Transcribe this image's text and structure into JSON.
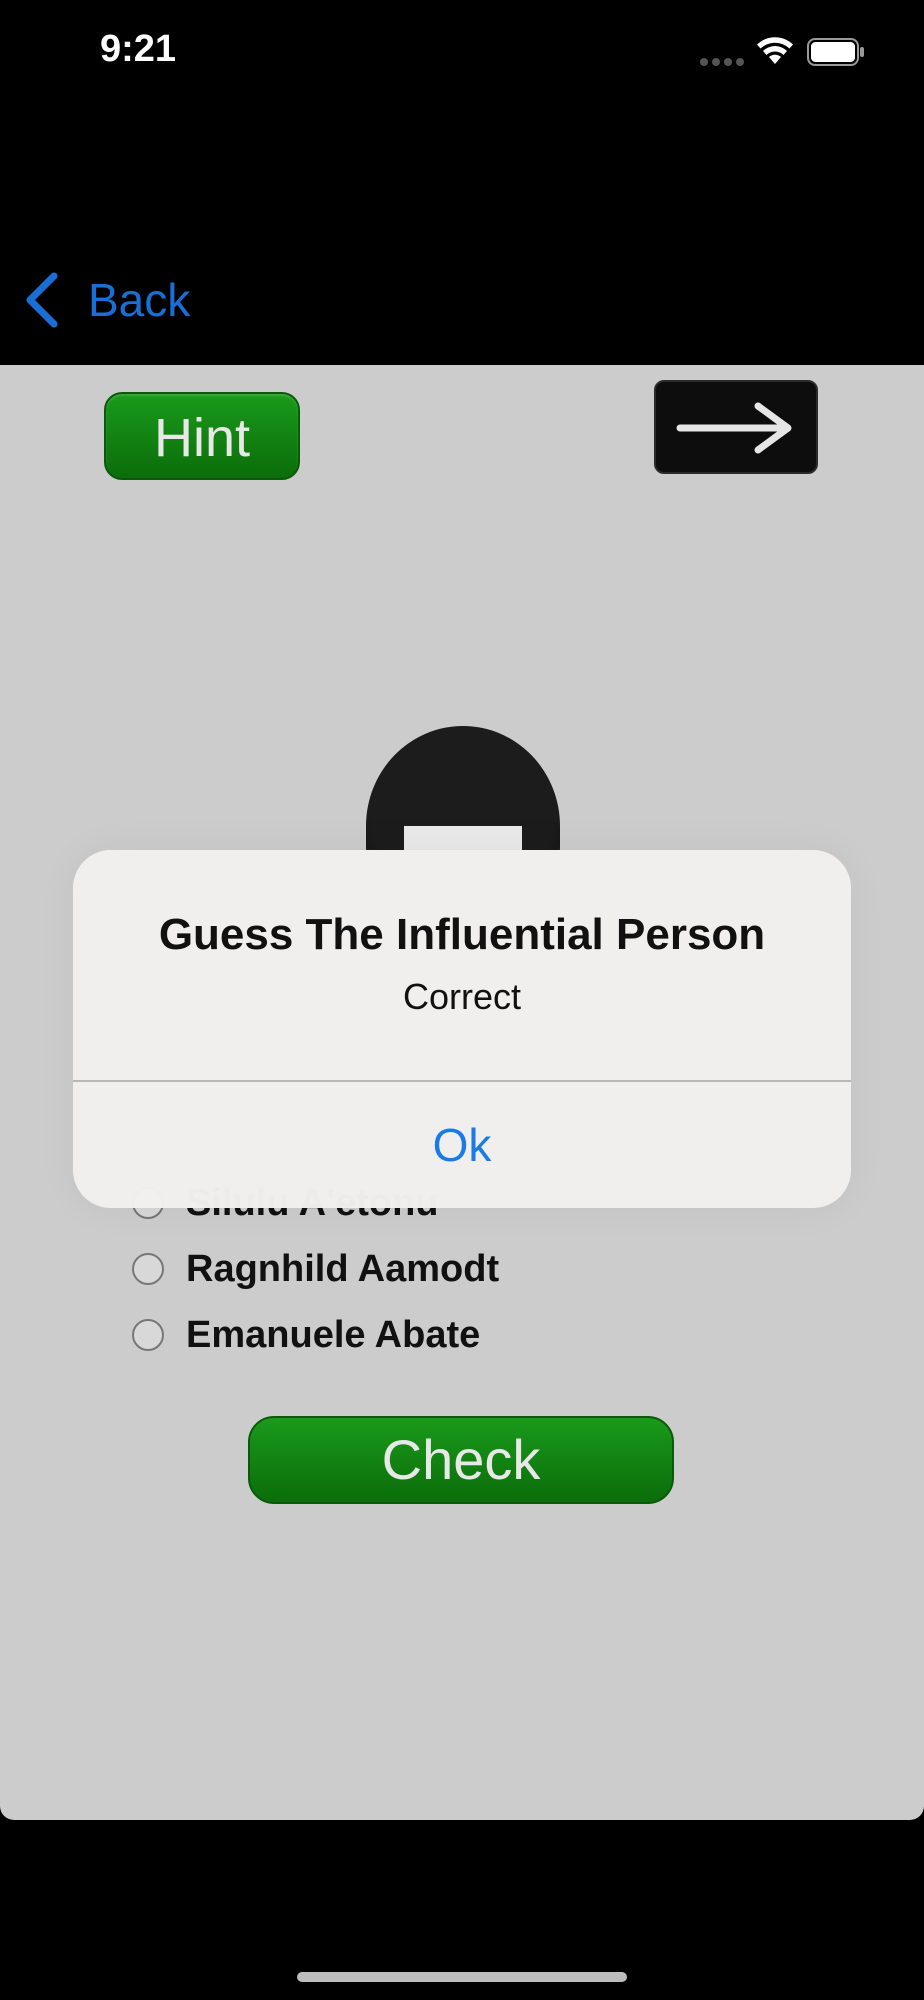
{
  "status_bar": {
    "time": "9:21"
  },
  "nav": {
    "back_label": "Back"
  },
  "quiz": {
    "hint_label": "Hint",
    "next_icon": "arrow-right-icon",
    "options": [
      {
        "label": "Silulu A'etonu"
      },
      {
        "label": "Ragnhild Aamodt"
      },
      {
        "label": "Emanuele Abate"
      }
    ],
    "check_label": "Check"
  },
  "alert": {
    "title": "Guess The Influential Person",
    "message": "Correct",
    "ok_label": "Ok"
  },
  "colors": {
    "accent": "#1a7ae6",
    "button_green": "#0f7d0f",
    "content_bg": "#cccccc"
  }
}
